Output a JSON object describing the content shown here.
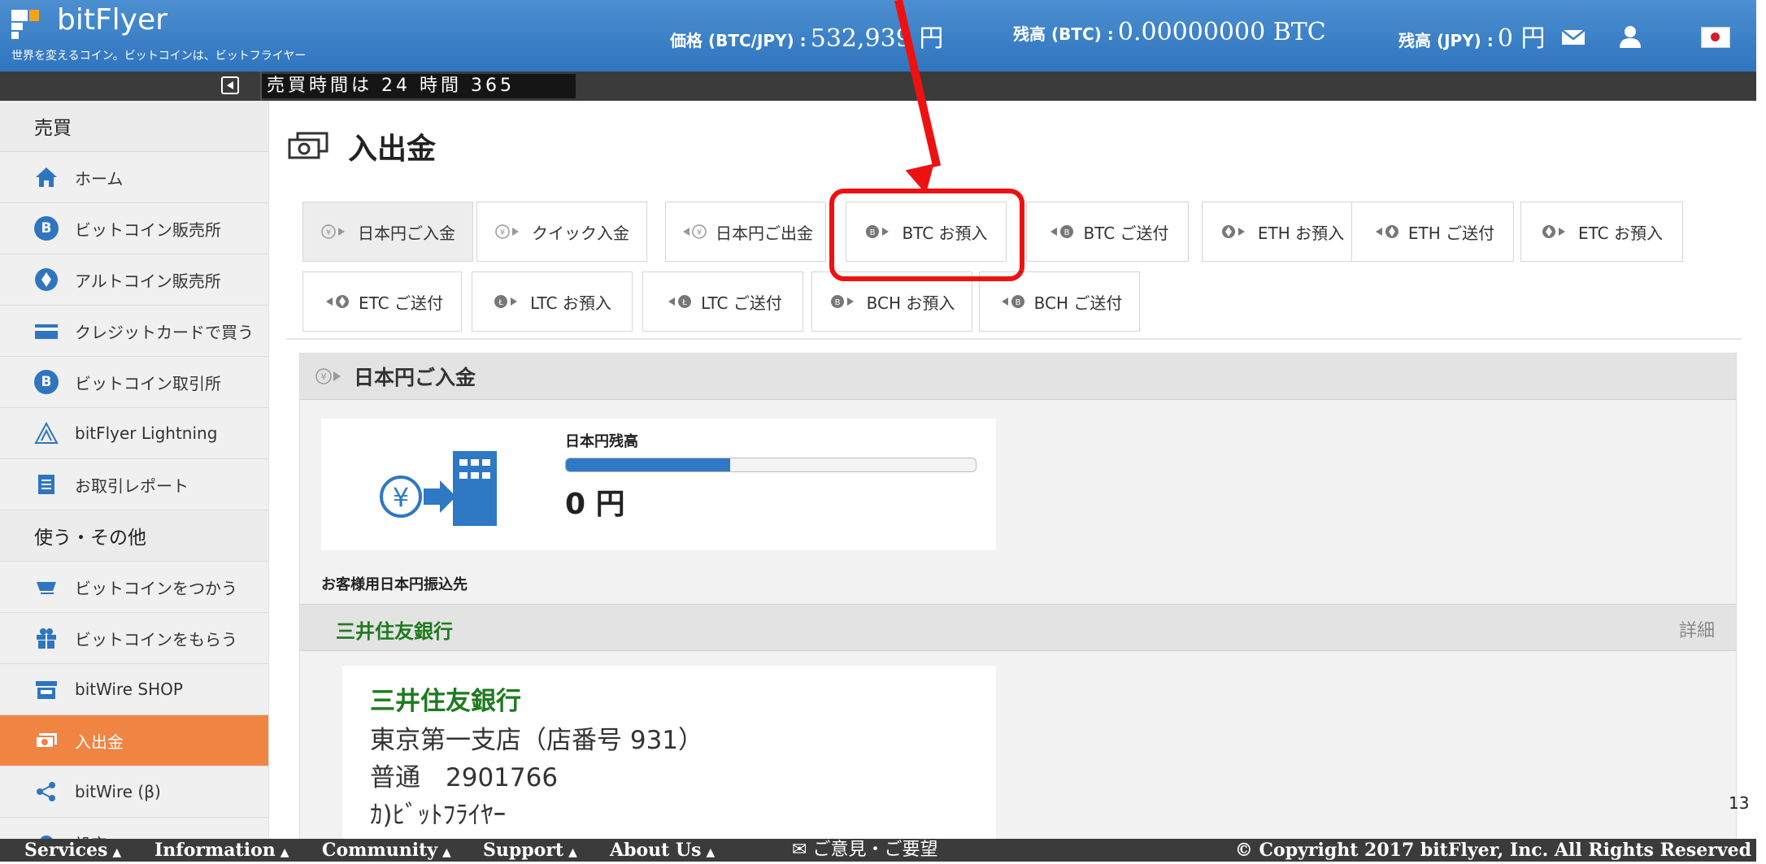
{
  "header": {
    "logo_text": "bitFlyer",
    "slogan": "世界を変えるコイン。ビットコインは、ビットフライヤー",
    "price_label": "価格 (BTC/JPY) :",
    "price_value": "532,939 円",
    "btc_balance_label": "残高 (BTC) :",
    "btc_balance_value": "0.00000000 BTC",
    "jpy_balance_label": "残高 (JPY) :",
    "jpy_balance_value": "0 円",
    "icons": [
      "mail-icon",
      "user-icon",
      "japan-flag-icon"
    ]
  },
  "ticker": {
    "text": "売買時間は 24 時間 365"
  },
  "sidebar": {
    "sections": [
      {
        "title": "売買",
        "items": [
          {
            "label": "ホーム",
            "icon": "home-icon"
          },
          {
            "label": "ビットコイン販売所",
            "icon": "bitcoin-icon"
          },
          {
            "label": "アルトコイン販売所",
            "icon": "altcoin-icon"
          },
          {
            "label": "クレジットカードで買う",
            "icon": "credit-card-icon"
          },
          {
            "label": "ビットコイン取引所",
            "icon": "bitcoin-icon"
          },
          {
            "label": "bitFlyer Lightning",
            "icon": "lightning-icon"
          },
          {
            "label": "お取引レポート",
            "icon": "report-icon"
          }
        ]
      },
      {
        "title": "使う・その他",
        "items": [
          {
            "label": "ビットコインをつかう",
            "icon": "cart-icon"
          },
          {
            "label": "ビットコインをもらう",
            "icon": "gift-icon"
          },
          {
            "label": "bitWire SHOP",
            "icon": "shop-icon"
          },
          {
            "label": "入出金",
            "icon": "money-icon"
          },
          {
            "label": "bitWire (β)",
            "icon": "share-icon"
          },
          {
            "label": "設定",
            "icon": "settings-icon"
          }
        ]
      }
    ]
  },
  "main": {
    "page_title": "入出金",
    "tabs_row1": [
      "日本円ご入金",
      "クイック入金",
      "日本円ご出金",
      "BTC お預入",
      "BTC ご送付",
      "ETH お預入",
      "ETH ご送付",
      "ETC お預入"
    ],
    "tabs_row2": [
      "ETC ご送付",
      "LTC お預入",
      "LTC ご送付",
      "BCH お預入",
      "BCH ご送付"
    ],
    "active_tab": "日本円ご入金",
    "highlighted_tab": "BTC お預入",
    "panel_title": "日本円ご入金",
    "balance_label": "日本円残高",
    "balance_value": "0 円",
    "balance_bar_fraction": 0.4,
    "recipient_label": "お客様用日本円振込先",
    "bank_name": "三井住友銀行",
    "bank_detail_link": "詳細",
    "bank_branch": "東京第一支店（店番号 931）",
    "account": "普通　2901766",
    "account_holder": "ｶ)ﾋﾞｯﾄﾌﾗｲﾔｰ"
  },
  "page_number": "13",
  "footer": {
    "nav": [
      "Services",
      "Information",
      "Community",
      "Support",
      "About Us"
    ],
    "feedback": "ご意見・ご要望",
    "copyright": "© Copyright 2017 bitFlyer, Inc. All Rights Reserved"
  },
  "colors": {
    "header_blue": "#3a82c8",
    "accent_orange": "#f08443",
    "highlight_red": "#ee1111",
    "bank_green": "#1e7a1e"
  }
}
